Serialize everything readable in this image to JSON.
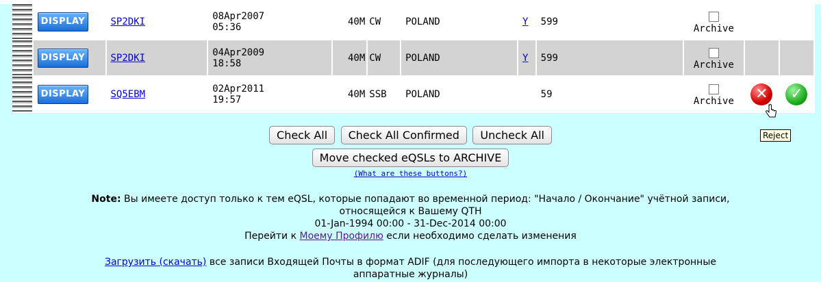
{
  "rows": [
    {
      "display": "DISPLAY",
      "call": "SP2DKI",
      "date": "08Apr2007",
      "time": "05:36",
      "band": "40M",
      "mode": "CW",
      "country": "POLAND",
      "confirmed": "Y",
      "rst": "599",
      "archive": "Archive",
      "style": "white"
    },
    {
      "display": "DISPLAY",
      "call": "SP2DKI",
      "date": "04Apr2009",
      "time": "18:58",
      "band": "40M",
      "mode": "CW",
      "country": "POLAND",
      "confirmed": "Y",
      "rst": "599",
      "archive": "Archive",
      "style": "grey"
    },
    {
      "display": "DISPLAY",
      "call": "SQ5EBM",
      "date": "02Apr2011",
      "time": "19:57",
      "band": "40M",
      "mode": "SSB",
      "country": "POLAND",
      "confirmed": "",
      "rst": "59",
      "archive": "Archive",
      "style": "white"
    }
  ],
  "buttons": {
    "check_all": "Check All",
    "check_all_confirmed": "Check All Confirmed",
    "uncheck_all": "Uncheck All",
    "move_archive": "Move checked eQSLs to ARCHIVE"
  },
  "what_link": "(What are these buttons?)",
  "note": {
    "label": "Note:",
    "text1": " Вы имеете доступ только к тем eQSL, которые попадают во временной период: \"Начало / Окончание\" учётной записи,",
    "text2": "относящейся к Вашему QTH",
    "period": "01-Jan-1994 00:00 - 31-Dec-2014 00:00",
    "profile_pre": "Перейти к ",
    "profile_link": "Моему Профилю",
    "profile_post": " если необходимо сделать изменения"
  },
  "download": {
    "link": "Загрузить (скачать)",
    "text1": " все записи Входящей Почты в формат ADIF (для последующего импорта в некоторые электронные",
    "text2": "аппаратные журналы)"
  },
  "tooltip": "Reject",
  "icons": {
    "reject": "reject-icon",
    "confirm": "confirm-icon"
  },
  "colors": {
    "background": "#ccffff",
    "row_alt": "#d3d3d3",
    "link": "#0000cc"
  }
}
